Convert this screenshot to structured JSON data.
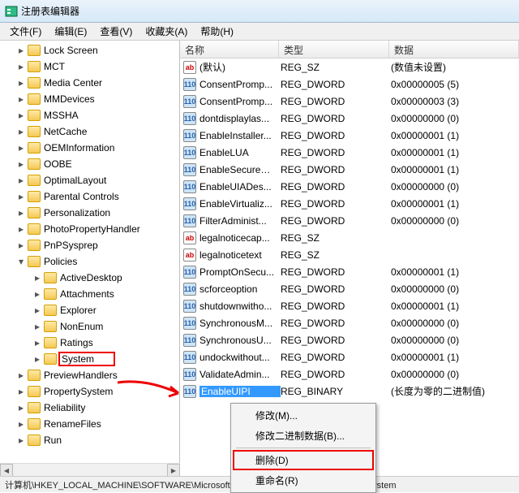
{
  "window": {
    "title": "注册表编辑器"
  },
  "menubar": [
    "文件(F)",
    "编辑(E)",
    "查看(V)",
    "收藏夹(A)",
    "帮助(H)"
  ],
  "tree": [
    {
      "label": "Lock Screen",
      "indent": false
    },
    {
      "label": "MCT",
      "indent": false
    },
    {
      "label": "Media Center",
      "indent": false
    },
    {
      "label": "MMDevices",
      "indent": false
    },
    {
      "label": "MSSHA",
      "indent": false
    },
    {
      "label": "NetCache",
      "indent": false
    },
    {
      "label": "OEMInformation",
      "indent": false
    },
    {
      "label": "OOBE",
      "indent": false
    },
    {
      "label": "OptimalLayout",
      "indent": false
    },
    {
      "label": "Parental Controls",
      "indent": false
    },
    {
      "label": "Personalization",
      "indent": false
    },
    {
      "label": "PhotoPropertyHandler",
      "indent": false
    },
    {
      "label": "PnPSysprep",
      "indent": false
    },
    {
      "label": "Policies",
      "indent": false
    },
    {
      "label": "ActiveDesktop",
      "indent": true
    },
    {
      "label": "Attachments",
      "indent": true
    },
    {
      "label": "Explorer",
      "indent": true
    },
    {
      "label": "NonEnum",
      "indent": true
    },
    {
      "label": "Ratings",
      "indent": true
    },
    {
      "label": "System",
      "indent": true,
      "highlight": true
    },
    {
      "label": "PreviewHandlers",
      "indent": false
    },
    {
      "label": "PropertySystem",
      "indent": false
    },
    {
      "label": "Reliability",
      "indent": false
    },
    {
      "label": "RenameFiles",
      "indent": false
    },
    {
      "label": "Run",
      "indent": false
    }
  ],
  "list": {
    "headers": {
      "name": "名称",
      "type": "类型",
      "data": "数据"
    },
    "rows": [
      {
        "icon": "sz",
        "name": "(默认)",
        "type": "REG_SZ",
        "data": "(数值未设置)"
      },
      {
        "icon": "dw",
        "name": "ConsentPromp...",
        "type": "REG_DWORD",
        "data": "0x00000005 (5)"
      },
      {
        "icon": "dw",
        "name": "ConsentPromp...",
        "type": "REG_DWORD",
        "data": "0x00000003 (3)"
      },
      {
        "icon": "dw",
        "name": "dontdisplaylas...",
        "type": "REG_DWORD",
        "data": "0x00000000 (0)"
      },
      {
        "icon": "dw",
        "name": "EnableInstaller...",
        "type": "REG_DWORD",
        "data": "0x00000001 (1)"
      },
      {
        "icon": "dw",
        "name": "EnableLUA",
        "type": "REG_DWORD",
        "data": "0x00000001 (1)"
      },
      {
        "icon": "dw",
        "name": "EnableSecureU...",
        "type": "REG_DWORD",
        "data": "0x00000001 (1)"
      },
      {
        "icon": "dw",
        "name": "EnableUIADes...",
        "type": "REG_DWORD",
        "data": "0x00000000 (0)"
      },
      {
        "icon": "dw",
        "name": "EnableVirtualiz...",
        "type": "REG_DWORD",
        "data": "0x00000001 (1)"
      },
      {
        "icon": "dw",
        "name": "FilterAdminist...",
        "type": "REG_DWORD",
        "data": "0x00000000 (0)"
      },
      {
        "icon": "sz",
        "name": "legalnoticecap...",
        "type": "REG_SZ",
        "data": ""
      },
      {
        "icon": "sz",
        "name": "legalnoticetext",
        "type": "REG_SZ",
        "data": ""
      },
      {
        "icon": "dw",
        "name": "PromptOnSecu...",
        "type": "REG_DWORD",
        "data": "0x00000001 (1)"
      },
      {
        "icon": "dw",
        "name": "scforceoption",
        "type": "REG_DWORD",
        "data": "0x00000000 (0)"
      },
      {
        "icon": "dw",
        "name": "shutdownwitho...",
        "type": "REG_DWORD",
        "data": "0x00000001 (1)"
      },
      {
        "icon": "dw",
        "name": "SynchronousM...",
        "type": "REG_DWORD",
        "data": "0x00000000 (0)"
      },
      {
        "icon": "dw",
        "name": "SynchronousU...",
        "type": "REG_DWORD",
        "data": "0x00000000 (0)"
      },
      {
        "icon": "dw",
        "name": "undockwithout...",
        "type": "REG_DWORD",
        "data": "0x00000001 (1)"
      },
      {
        "icon": "dw",
        "name": "ValidateAdmin...",
        "type": "REG_DWORD",
        "data": "0x00000000 (0)"
      },
      {
        "icon": "dw",
        "name": "EnableUIPI",
        "type": "REG_BINARY",
        "data": "(长度为零的二进制值)",
        "selected": true
      }
    ]
  },
  "context_menu": {
    "items": [
      {
        "label": "修改(M)...",
        "hl": false
      },
      {
        "label": "修改二进制数据(B)...",
        "hl": false
      },
      {
        "sep": true
      },
      {
        "label": "删除(D)",
        "hl": true
      },
      {
        "label": "重命名(R)",
        "hl": false
      }
    ]
  },
  "statusbar": "计算机\\HKEY_LOCAL_MACHINE\\SOFTWARE\\Microsoft\\Windows\\CurrentVersion\\Policies\\System"
}
